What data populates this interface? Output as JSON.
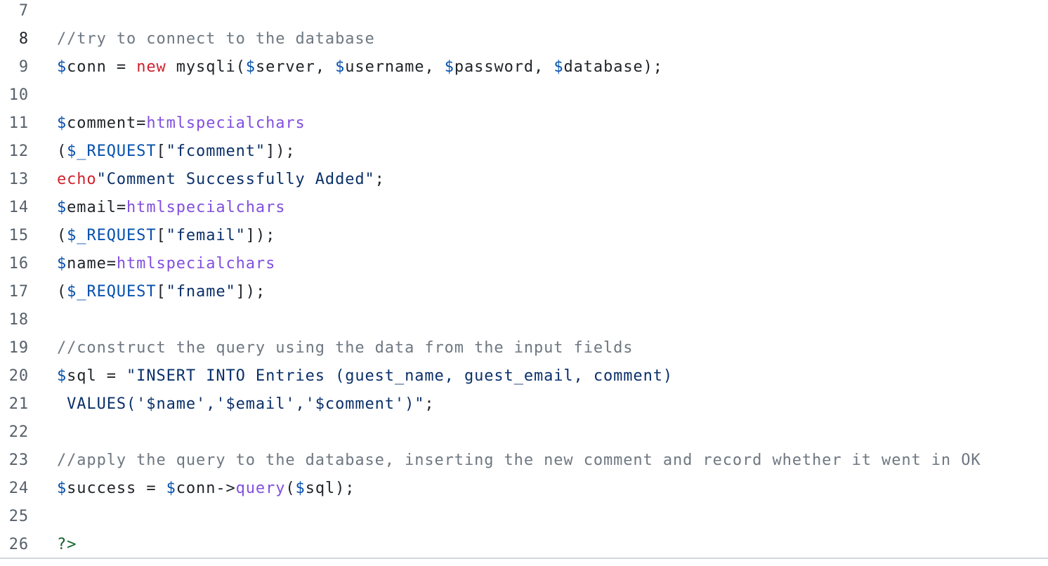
{
  "lines": [
    {
      "n": "7",
      "tokens": []
    },
    {
      "n": "8",
      "tokens": [
        {
          "t": "cm",
          "v": "//try to connect to the database"
        }
      ]
    },
    {
      "n": "9",
      "tokens": [
        {
          "t": "var",
          "v": "$"
        },
        {
          "t": "plain",
          "v": "conn = "
        },
        {
          "t": "kw",
          "v": "new"
        },
        {
          "t": "plain",
          "v": " mysqli("
        },
        {
          "t": "var",
          "v": "$"
        },
        {
          "t": "plain",
          "v": "server, "
        },
        {
          "t": "var",
          "v": "$"
        },
        {
          "t": "plain",
          "v": "username, "
        },
        {
          "t": "var",
          "v": "$"
        },
        {
          "t": "plain",
          "v": "password, "
        },
        {
          "t": "var",
          "v": "$"
        },
        {
          "t": "plain",
          "v": "database);"
        }
      ]
    },
    {
      "n": "10",
      "tokens": []
    },
    {
      "n": "11",
      "tokens": [
        {
          "t": "var",
          "v": "$"
        },
        {
          "t": "plain",
          "v": "comment="
        },
        {
          "t": "fn",
          "v": "htmlspecialchars"
        }
      ]
    },
    {
      "n": "12",
      "tokens": [
        {
          "t": "plain",
          "v": "("
        },
        {
          "t": "var",
          "v": "$_REQUEST"
        },
        {
          "t": "plain",
          "v": "["
        },
        {
          "t": "str",
          "v": "\"fcomment\""
        },
        {
          "t": "plain",
          "v": "]);"
        }
      ]
    },
    {
      "n": "13",
      "tokens": [
        {
          "t": "kw",
          "v": "echo"
        },
        {
          "t": "str",
          "v": "\"Comment Successfully Added\""
        },
        {
          "t": "plain",
          "v": ";"
        }
      ]
    },
    {
      "n": "14",
      "tokens": [
        {
          "t": "var",
          "v": "$"
        },
        {
          "t": "plain",
          "v": "email="
        },
        {
          "t": "fn",
          "v": "htmlspecialchars"
        }
      ]
    },
    {
      "n": "15",
      "tokens": [
        {
          "t": "plain",
          "v": "("
        },
        {
          "t": "var",
          "v": "$_REQUEST"
        },
        {
          "t": "plain",
          "v": "["
        },
        {
          "t": "str",
          "v": "\"femail\""
        },
        {
          "t": "plain",
          "v": "]);"
        }
      ]
    },
    {
      "n": "16",
      "tokens": [
        {
          "t": "var",
          "v": "$"
        },
        {
          "t": "plain",
          "v": "name="
        },
        {
          "t": "fn",
          "v": "htmlspecialchars"
        }
      ]
    },
    {
      "n": "17",
      "tokens": [
        {
          "t": "plain",
          "v": "("
        },
        {
          "t": "var",
          "v": "$_REQUEST"
        },
        {
          "t": "plain",
          "v": "["
        },
        {
          "t": "str",
          "v": "\"fname\""
        },
        {
          "t": "plain",
          "v": "]);"
        }
      ]
    },
    {
      "n": "18",
      "tokens": []
    },
    {
      "n": "19",
      "tokens": [
        {
          "t": "cm",
          "v": "//construct the query using the data from the input fields"
        }
      ]
    },
    {
      "n": "20",
      "tokens": [
        {
          "t": "var",
          "v": "$"
        },
        {
          "t": "plain",
          "v": "sql = "
        },
        {
          "t": "str",
          "v": "\"INSERT INTO Entries (guest_name, guest_email, comment)"
        }
      ]
    },
    {
      "n": "21",
      "tokens": [
        {
          "t": "str",
          "v": " VALUES('$name','$email','$comment')\""
        },
        {
          "t": "plain",
          "v": ";"
        }
      ]
    },
    {
      "n": "22",
      "tokens": []
    },
    {
      "n": "23",
      "tokens": [
        {
          "t": "cm",
          "v": "//apply the query to the database, inserting the new comment and record whether it went in OK"
        }
      ]
    },
    {
      "n": "24",
      "tokens": [
        {
          "t": "var",
          "v": "$"
        },
        {
          "t": "plain",
          "v": "success = "
        },
        {
          "t": "var",
          "v": "$"
        },
        {
          "t": "plain",
          "v": "conn->"
        },
        {
          "t": "fn",
          "v": "query"
        },
        {
          "t": "plain",
          "v": "("
        },
        {
          "t": "var",
          "v": "$"
        },
        {
          "t": "plain",
          "v": "sql);"
        }
      ]
    },
    {
      "n": "25",
      "tokens": []
    },
    {
      "n": "26",
      "tokens": [
        {
          "t": "tag",
          "v": "?>"
        }
      ]
    }
  ],
  "current_line": "8",
  "colors": {
    "variable": "#0550ae",
    "keyword": "#cf222e",
    "function": "#8250df",
    "string": "#0a3069",
    "comment": "#6e7781",
    "php_tag": "#116329",
    "line_number": "#57606a"
  }
}
